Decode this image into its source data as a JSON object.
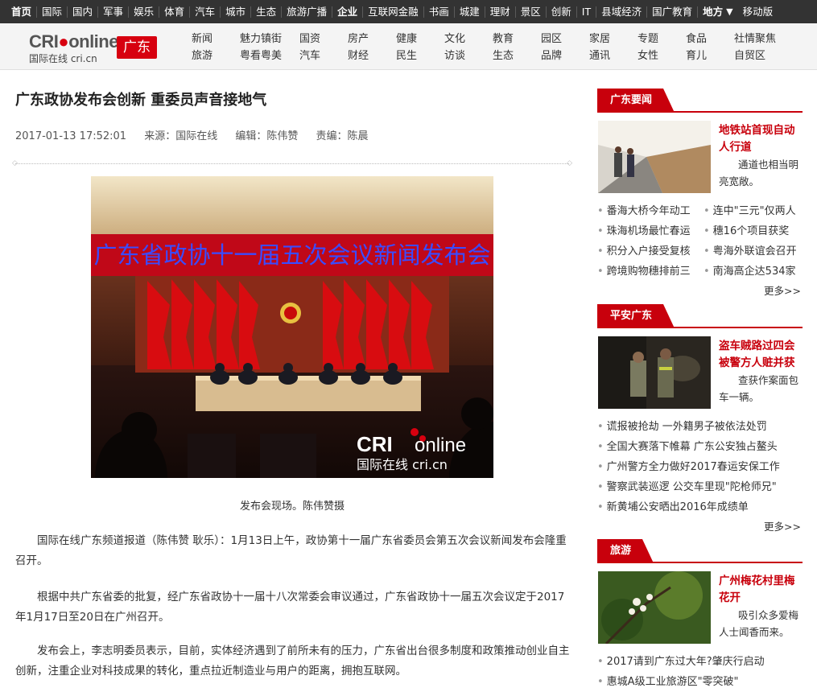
{
  "topnav": {
    "items": [
      "首页",
      "国际",
      "国内",
      "军事",
      "娱乐",
      "体育",
      "汽车",
      "城市",
      "生态",
      "旅游广播",
      "企业",
      "互联网金融",
      "书画",
      "城建",
      "理财",
      "景区",
      "创新",
      "IT",
      "县域经济",
      "国广教育",
      "地方",
      "移动版"
    ]
  },
  "header": {
    "logo_brand": "CRI",
    "logo_brand2": "online",
    "logo_sub": "国际在线 cri.cn",
    "region": "广东",
    "subnav": [
      [
        "新闻",
        "旅游"
      ],
      [
        "魅力镇街",
        "粤看粤美"
      ],
      [
        "国资",
        "汽车"
      ],
      [
        "房产",
        "财经"
      ],
      [
        "健康",
        "民生"
      ],
      [
        "文化",
        "访谈"
      ],
      [
        "教育",
        "生态"
      ],
      [
        "园区",
        "品牌"
      ],
      [
        "家居",
        "通讯"
      ],
      [
        "专题",
        "女性"
      ],
      [
        "食品",
        "育儿"
      ],
      [
        "社情聚焦",
        "自贸区"
      ]
    ]
  },
  "article": {
    "title": "广东政协发布会创新 重委员声音接地气",
    "date": "2017-01-13 17:52:01",
    "source": "来源：国际在线",
    "editor": "编辑：陈伟赞",
    "responsible": "责编：陈晨",
    "photo_banner": "广东省政协十一届五次会议新闻发布会",
    "photo_watermark_1": "CRI",
    "photo_watermark_2": "online",
    "photo_watermark_3": "国际在线 cri.cn",
    "caption": "发布会现场。陈伟赞摄",
    "paragraphs": [
      "国际在线广东频道报道（陈伟赞 耿乐）：1月13日上午，政协第十一届广东省委员会第五次会议新闻发布会隆重召开。",
      "根据中共广东省委的批复，经广东省政协十一届十八次常委会审议通过，广东省政协十一届五次会议定于2017年1月17日至20日在广州召开。",
      "发布会上，李志明委员表示，目前，实体经济遇到了前所未有的压力，广东省出台很多制度和政策推动创业自主创新，注重企业对科技成果的转化，重点拉近制造业与用户的距离，拥抱互联网。"
    ]
  },
  "sidebar": {
    "sections": [
      {
        "tab": "广东要闻",
        "feature_title": "地铁站首现自动人行道",
        "feature_desc": "通道也相当明亮宽敞。",
        "rows": [
          [
            "番海大桥今年动工",
            "连中\"三元\"仅两人"
          ],
          [
            "珠海机场最忙春运",
            "穗16个项目获奖"
          ],
          [
            "积分入户接受复核",
            "粤海外联谊会召开"
          ],
          [
            "跨境购物穗排前三",
            "南海高企达534家"
          ]
        ],
        "more": "更多>>"
      },
      {
        "tab": "平安广东",
        "feature_title": "盗车贼路过四会被警方人赃并获",
        "feature_desc": "查获作案面包车一辆。",
        "rows": [
          [
            "谎报被抢劫 一外籍男子被依法处罚"
          ],
          [
            "全国大赛落下帷幕 广东公安独占鳌头"
          ],
          [
            "广州警方全力做好2017春运安保工作"
          ],
          [
            "警察武装巡逻 公交车里现\"陀枪师兄\""
          ],
          [
            "新黄埔公安晒出2016年成绩单"
          ]
        ],
        "more": "更多>>"
      },
      {
        "tab": "旅游",
        "feature_title": "广州梅花村里梅花开",
        "feature_desc": "吸引众多爱梅人士闻香而来。",
        "rows": [
          [
            "2017请到广东过大年?肇庆行启动"
          ],
          [
            "惠城A级工业旅游区\"零突破\""
          ]
        ],
        "more": ""
      }
    ]
  }
}
